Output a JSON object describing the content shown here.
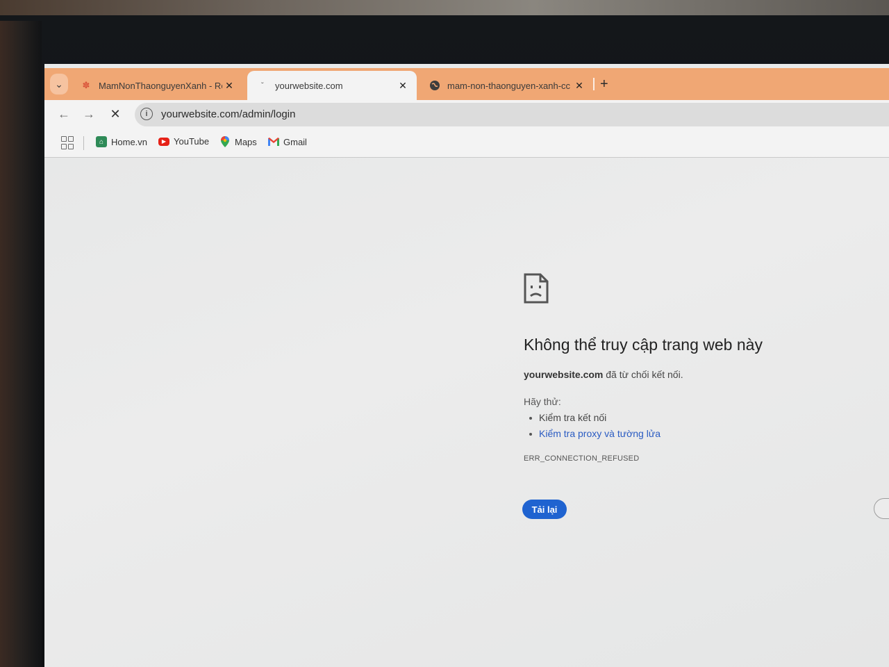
{
  "browser": {
    "tabs": [
      {
        "title": "MamNonThaonguyenXanh - Re",
        "favicon": "sparkle-icon",
        "active": false
      },
      {
        "title": "yourwebsite.com",
        "favicon": "loading-icon",
        "active": true
      },
      {
        "title": "mam-non-thaonguyen-xanh-cc",
        "favicon": "globe-icon",
        "active": false
      }
    ],
    "url": "yourwebsite.com/admin/login",
    "bookmarks": [
      {
        "label": "Home.vn",
        "icon": "home-vn-icon"
      },
      {
        "label": "YouTube",
        "icon": "youtube-icon"
      },
      {
        "label": "Maps",
        "icon": "maps-icon"
      },
      {
        "label": "Gmail",
        "icon": "gmail-icon"
      }
    ],
    "colors": {
      "tabstrip": "#f0a774",
      "link": "#2a5bc2",
      "button": "#1f63d0"
    }
  },
  "error_page": {
    "title": "Không thể truy cập trang web này",
    "host": "yourwebsite.com",
    "desc_rest": " đã từ chối kết nối.",
    "try_label": "Hãy thử:",
    "suggestions": [
      "Kiểm tra kết nối",
      "Kiểm tra proxy và tường lửa"
    ],
    "error_code": "ERR_CONNECTION_REFUSED",
    "reload_label": "Tải lại"
  }
}
